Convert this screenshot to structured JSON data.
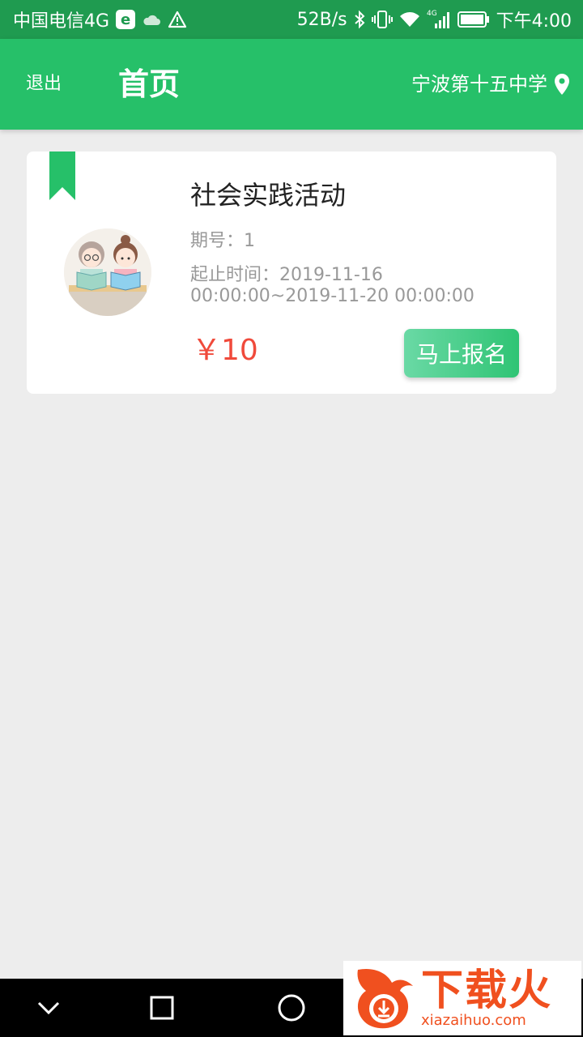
{
  "status_bar": {
    "carrier": "中国电信4G",
    "e_badge": "e",
    "net_speed": "52B/s",
    "network_small": "4G",
    "time": "下午4:00",
    "icons": [
      "cloud-icon",
      "warning-icon",
      "bluetooth-icon",
      "vibrate-icon",
      "wifi-icon",
      "signal-icon",
      "battery-icon"
    ]
  },
  "header": {
    "logout_label": "退出",
    "title": "首页",
    "location": "宁波第十五中学",
    "color": "#26c069"
  },
  "activity": {
    "title": "社会实践活动",
    "issue": "期号：1",
    "period": "起止时间：2019-11-16 00:00:00~2019-11-20 00:00:00",
    "price": "￥10",
    "signup_label": "马上报名",
    "price_color": "#f04a3b"
  },
  "nav_bar": {
    "icons": [
      "back-chevron-icon",
      "recents-square-icon",
      "home-circle-icon"
    ]
  },
  "watermark": {
    "brand": "下载火",
    "url": "xiazaihuo.com"
  }
}
